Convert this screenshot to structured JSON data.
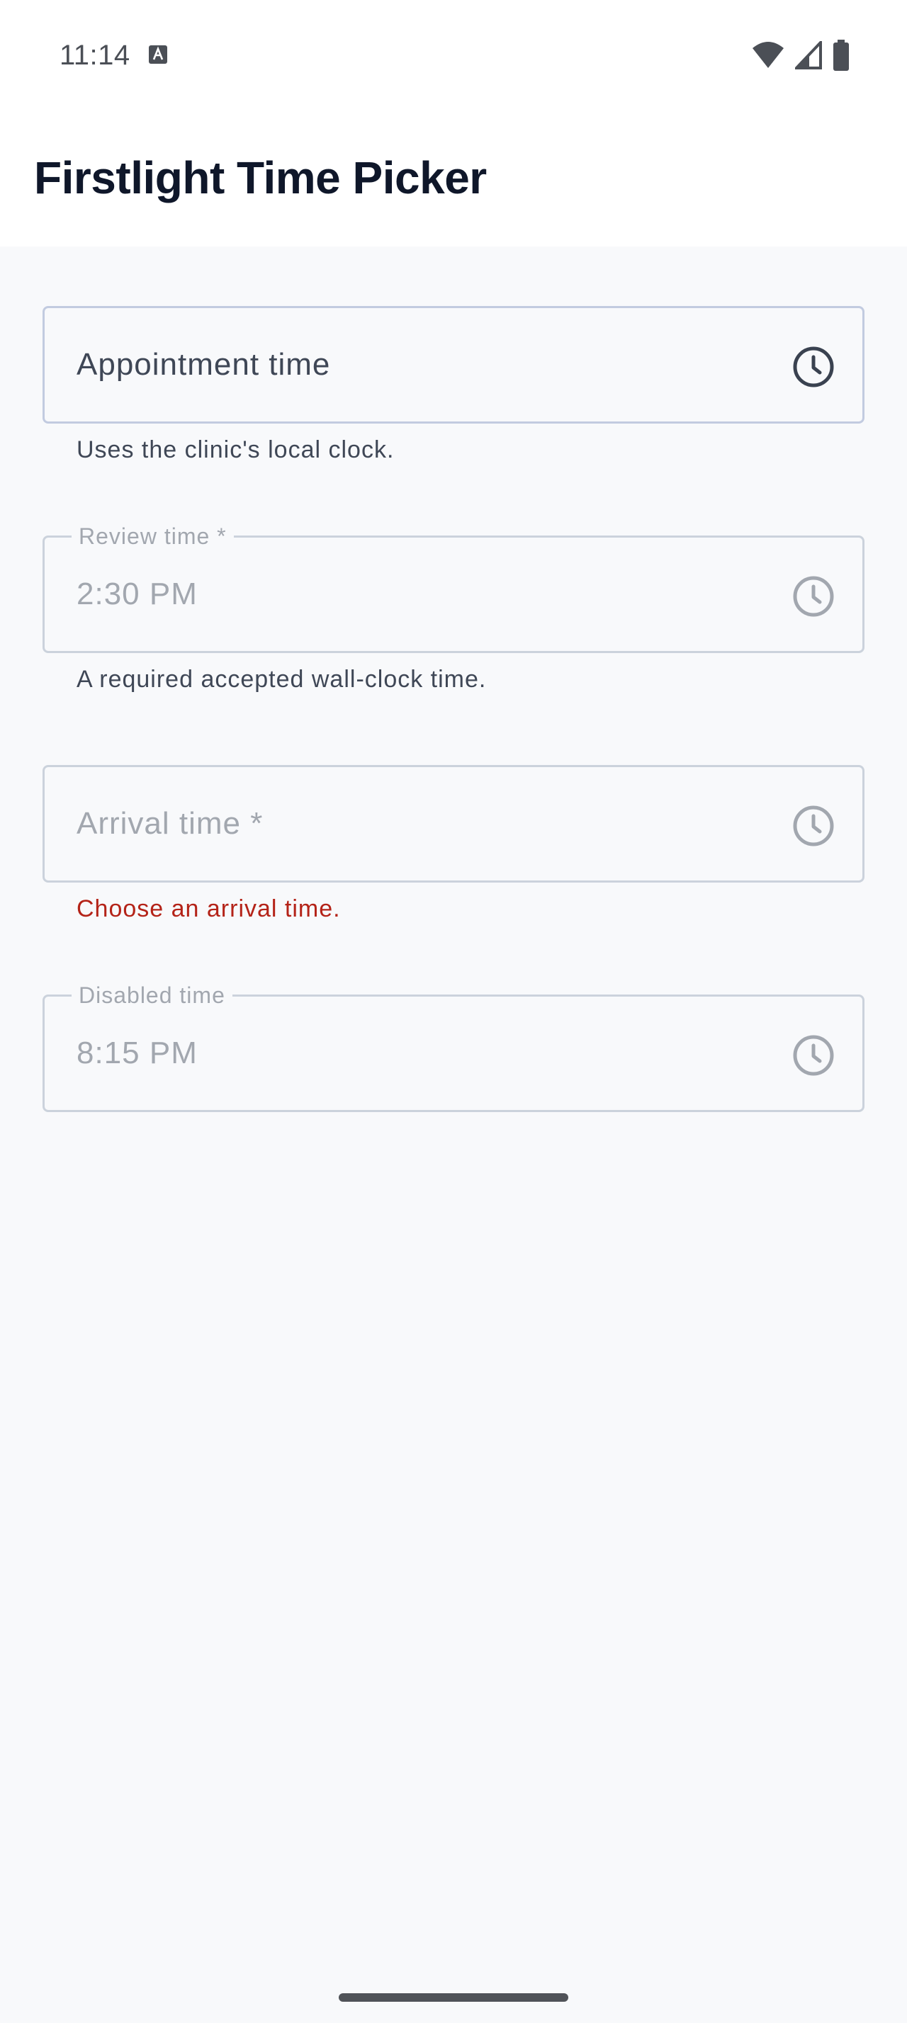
{
  "status_bar": {
    "time": "11:14",
    "icons": [
      "notification-a-icon",
      "wifi-icon",
      "signal-icon",
      "battery-icon"
    ]
  },
  "app_bar": {
    "title": "Firstlight Time Picker"
  },
  "fields": [
    {
      "label": "Appointment time",
      "value": "",
      "placeholder": "Appointment time",
      "helper": "Uses the clinic's local clock.",
      "state": "focused",
      "icon": "clock-icon"
    },
    {
      "label": "Review time *",
      "value": "2:30 PM",
      "helper": "A required accepted wall-clock time.",
      "state": "filled",
      "icon": "clock-icon"
    },
    {
      "label": "Arrival time *",
      "value": "",
      "placeholder": "Arrival time *",
      "helper": "Choose an arrival time.",
      "state": "error",
      "icon": "clock-icon"
    },
    {
      "label": "Disabled time",
      "value": "8:15 PM",
      "helper": "",
      "state": "disabled",
      "icon": "clock-icon"
    }
  ],
  "colors": {
    "background": "#f8f9fb",
    "title": "#0f172a",
    "field_border": "#cbd2dc",
    "text_strong": "#3f4756",
    "text_muted": "#a2a7af",
    "error": "#b42318"
  }
}
